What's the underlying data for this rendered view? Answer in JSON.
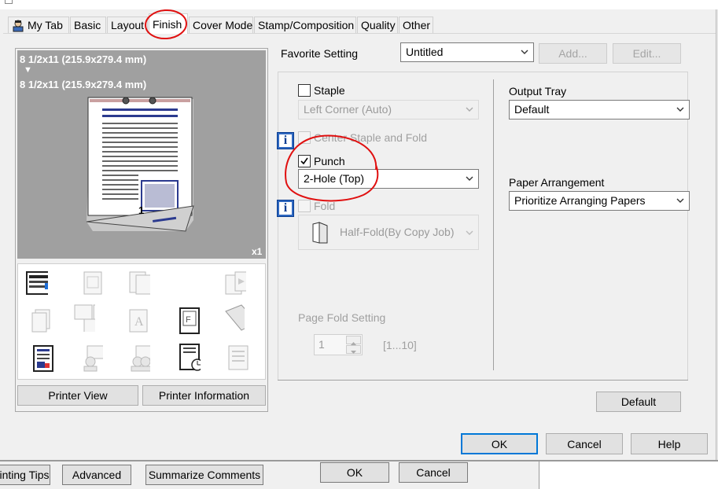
{
  "tabs": [
    {
      "label": "My Tab"
    },
    {
      "label": "Basic"
    },
    {
      "label": "Layout"
    },
    {
      "label": "Finish"
    },
    {
      "label": "Cover Mode"
    },
    {
      "label": "Stamp/Composition"
    },
    {
      "label": "Quality"
    },
    {
      "label": "Other"
    }
  ],
  "active_tab": "Finish",
  "preview": {
    "paper_line_1": "8 1/2x11 (215.9x279.4 mm)",
    "arrow": "▼",
    "paper_line_2": "8 1/2x11 (215.9x279.4 mm)",
    "copies": "x1",
    "page_number": "1",
    "printer_view": "Printer View",
    "printer_information": "Printer Information"
  },
  "favorite": {
    "label": "Favorite Setting",
    "value": "Untitled",
    "add": "Add...",
    "edit": "Edit..."
  },
  "staple": {
    "label": "Staple",
    "checked": false,
    "value": "Left Corner (Auto)"
  },
  "center_staple": {
    "label": "Center Staple and Fold",
    "enabled": false
  },
  "punch": {
    "label": "Punch",
    "checked": true,
    "value": "2-Hole (Top)"
  },
  "fold": {
    "label": "Fold",
    "enabled": false,
    "value": "Half-Fold(By Copy Job)"
  },
  "page_fold": {
    "label": "Page Fold Setting",
    "value": "1",
    "range": "[1...10]"
  },
  "output_tray": {
    "label": "Output Tray",
    "value": "Default"
  },
  "paper_arrangement": {
    "label": "Paper Arrangement",
    "value": "Prioritize Arranging Papers"
  },
  "buttons": {
    "default": "Default",
    "ok": "OK",
    "cancel": "Cancel",
    "help": "Help"
  },
  "background_window": {
    "printing_tips": "inting Tips",
    "advanced": "Advanced",
    "summarize": "Summarize Comments",
    "ok": "OK",
    "cancel": "Cancel"
  },
  "colors": {
    "annotation": "#e01010",
    "accent": "#0078d7",
    "preview_gray": "#a0a0a0"
  }
}
